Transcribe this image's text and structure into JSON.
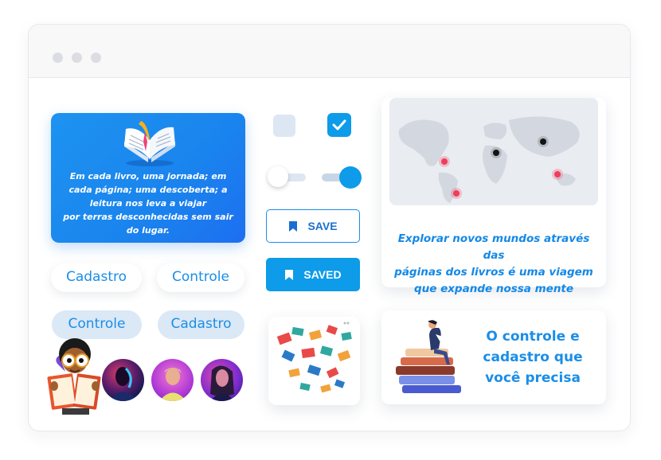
{
  "window": {
    "controls": [
      "dot-1",
      "dot-2",
      "dot-3"
    ]
  },
  "quote_card": {
    "icon": "open-book-icon",
    "lines": [
      "Em cada livro, uma jornada; em",
      "cada página; uma descoberta; a",
      "leitura nos leva a viajar",
      "por terras desconhecidas sem sair",
      "do lugar."
    ]
  },
  "pills": {
    "row1": [
      "Cadastro",
      "Controle"
    ],
    "row2": [
      "Controle",
      "Cadastro"
    ]
  },
  "controls": {
    "checkbox_unchecked": false,
    "checkbox_checked": true,
    "toggle_off": false,
    "toggle_on": true
  },
  "buttons": {
    "save_label": "SAVE",
    "saved_label": "SAVED",
    "icon": "bookmark-icon"
  },
  "map_card": {
    "caption_lines": [
      "Explorar novos mundos através das",
      "páginas dos livros é uma viagem",
      "que expande nossa mente"
    ]
  },
  "control_card": {
    "lines": [
      "O controle e",
      "cadastro que",
      "você precisa"
    ]
  },
  "colors": {
    "accent": "#1a8ee8",
    "button": "#0d9bea",
    "pin_red": "#ef3d5c",
    "pin_black": "#141414"
  }
}
